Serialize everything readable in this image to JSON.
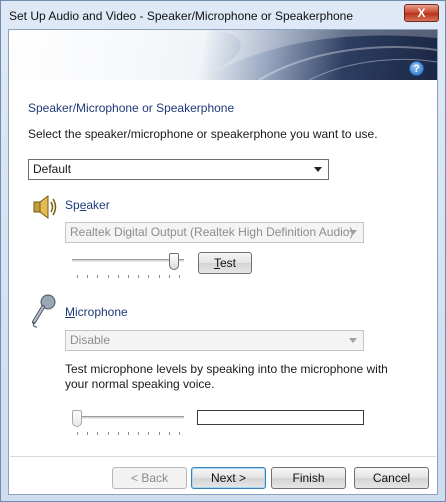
{
  "window": {
    "title": "Set Up Audio and Video - Speaker/Microphone or Speakerphone",
    "close_glyph": "X"
  },
  "help_glyph": "?",
  "section_title": "Speaker/Microphone or Speakerphone",
  "instructions": "Select the speaker/microphone or speakerphone you want to use.",
  "device_select": {
    "value": "Default"
  },
  "speaker": {
    "label_underlined": "e",
    "label_prefix": "Sp",
    "label_suffix": "aker",
    "device": "Realtek Digital Output (Realtek High Definition Audio)",
    "volume_fraction": 0.95,
    "test_button_underlined": "T",
    "test_button_rest": "est"
  },
  "microphone": {
    "label_underlined": "M",
    "label_rest": "icrophone",
    "device": "Disable",
    "instructions": "Test microphone levels by speaking into the microphone with your normal speaking voice.",
    "level_fraction": 0.0
  },
  "footer": {
    "back_label": "< Back",
    "next_label": "Next >",
    "finish_label": "Finish",
    "cancel_label": "Cancel"
  }
}
